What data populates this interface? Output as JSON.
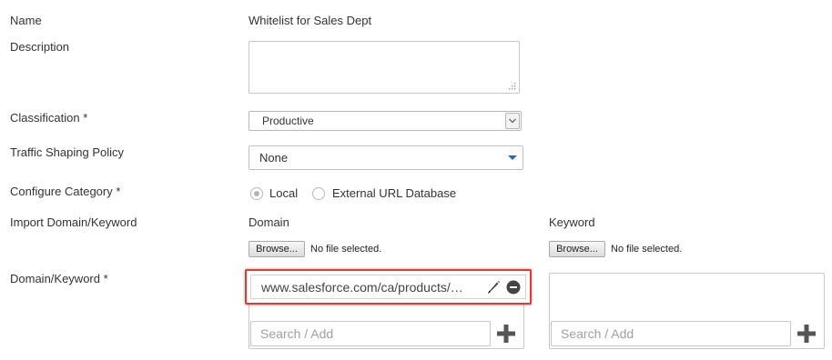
{
  "form": {
    "name_label": "Name",
    "name_value": "Whitelist for Sales Dept",
    "description_label": "Description",
    "description_value": "",
    "classification_label": "Classification *",
    "classification_value": "Productive",
    "traffic_label": "Traffic Shaping Policy",
    "traffic_value": "None",
    "configure_label": "Configure Category *",
    "configure_options": [
      {
        "label": "Local",
        "selected": true
      },
      {
        "label": "External URL Database",
        "selected": false
      }
    ],
    "import_label": "Import Domain/Keyword",
    "domain_keyword_label": "Domain/Keyword *"
  },
  "domain": {
    "header": "Domain",
    "browse_label": "Browse...",
    "file_status": "No file selected.",
    "items": [
      "www.salesforce.com/ca/products/sales-cloud/"
    ],
    "search_placeholder": "Search / Add"
  },
  "keyword": {
    "header": "Keyword",
    "browse_label": "Browse...",
    "file_status": "No file selected.",
    "items": [],
    "search_placeholder": "Search / Add"
  },
  "colors": {
    "highlight": "#e53935",
    "dropdown_caret": "#1d6fb8",
    "icon": "#444444"
  },
  "icons": [
    "resize-grip-icon",
    "chevron-down-icon",
    "caret-down-icon",
    "pencil-icon",
    "minus-circle-icon",
    "plus-icon"
  ]
}
